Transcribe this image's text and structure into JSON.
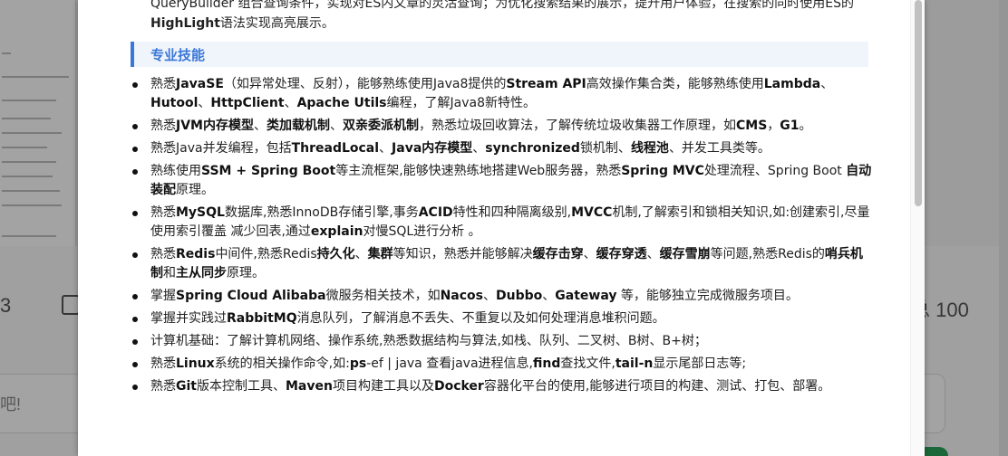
{
  "background": {
    "stat_left": "3",
    "stat_right": "总 100",
    "input_placeholder": "吧!"
  },
  "modal": {
    "intro": [
      "QueryBuilder 组合查询条件，实现对ES内文章的灵活查询；为优化搜索结果的展示，提升用户体验，在搜索的同时使用ES的",
      "HighLight",
      "语法实现高亮展示。"
    ],
    "section_title": "专业技能",
    "skills": [
      [
        "熟悉",
        "JavaSE",
        "（如异常处理、反射），能够熟练使用Java8提供的",
        "Stream API",
        "高效操作集合类，能够熟练使用",
        "Lambda",
        "、",
        "Hutool",
        "、",
        "HttpClient",
        "、",
        "Apache Utils",
        "编程，了解Java8新特性。"
      ],
      [
        "熟悉",
        "JVM内存模型",
        "、",
        "类加载机制",
        "、",
        "双亲委派机制",
        "，熟悉垃圾回收算法，了解传统垃圾收集器工作原理，如",
        "CMS",
        "，",
        "G1",
        "。"
      ],
      [
        "熟悉Java并发编程，包括",
        "ThreadLocal",
        "、",
        "Java内存模型",
        "、",
        "synchronized",
        "锁机制、",
        "线程池",
        "、并发工具类等。"
      ],
      [
        "熟练使用",
        "SSM + Spring Boot",
        "等主流框架,能够快速熟练地搭建Web服务器，熟悉",
        "Spring MVC",
        "处理流程、Spring Boot ",
        "自动装配",
        "原理。"
      ],
      [
        "熟悉",
        "MySQL",
        "数据库,熟悉InnoDB存储引擎,事务",
        "ACID",
        "特性和四种隔离级别,",
        "MVCC",
        "机制,了解索引和锁相关知识,如:创建索引,尽量使用索引覆盖 减少回表,通过",
        "explain",
        "对慢SQL进行分析 。"
      ],
      [
        "熟悉",
        "Redis",
        "中间件,熟悉Redis",
        "持久化",
        "、",
        "集群",
        "等知识，熟悉并能够解决",
        "缓存击穿",
        "、",
        "缓存穿透",
        "、",
        "缓存雪崩",
        "等问题,熟悉Redis的",
        "哨兵机制",
        "和",
        "主从同步",
        "原理。"
      ],
      [
        "掌握",
        "Spring Cloud Alibaba",
        "微服务相关技术，如",
        "Nacos",
        "、",
        "Dubbo",
        "、",
        "Gateway",
        " 等，能够独立完成微服务项目。"
      ],
      [
        "掌握并实践过",
        "RabbitMQ",
        "消息队列，了解消息不丢失、不重复以及如何处理消息堆积问题。"
      ],
      [
        "计算机基础：了解计算机网络、操作系统,熟悉数据结构与算法,如栈、队列、二叉树、B树、B+树；"
      ],
      [
        "熟悉",
        "Linux",
        "系统的相关操作命令,如:",
        "ps",
        "-ef | java 查看java进程信息,",
        "find",
        "查找文件,",
        "tail-n",
        "显示尾部日志等;"
      ],
      [
        "熟悉",
        "Git",
        "版本控制工具、",
        "Maven",
        "项目构建工具以及",
        "Docker",
        "容器化平台的使用,能够进行项目的构建、测试、打包、部署。"
      ]
    ]
  }
}
